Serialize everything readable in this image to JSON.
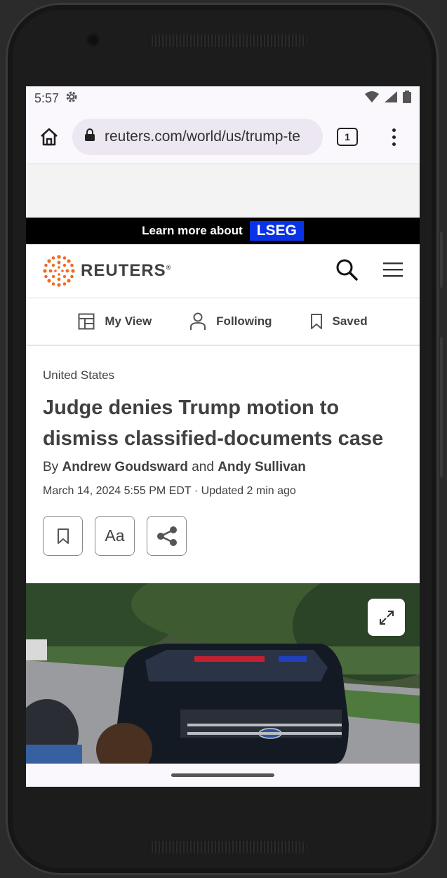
{
  "status_bar": {
    "time": "5:57"
  },
  "browser": {
    "url": "reuters.com/world/us/trump-te",
    "tab_count": "1"
  },
  "ad": {
    "text": "Learn more about",
    "brand": "LSEG"
  },
  "site": {
    "logo_text": "REUTERS",
    "registered": "®"
  },
  "subnav": [
    {
      "label": "My View"
    },
    {
      "label": "Following"
    },
    {
      "label": "Saved"
    }
  ],
  "article": {
    "kicker": "United States",
    "headline": "Judge denies Trump motion to dismiss classified-documents case",
    "byline_prefix": "By",
    "author1": "Andrew Goudsward",
    "byline_and": "and",
    "author2": "Andy Sullivan",
    "dateline": "March 14, 2024 5:55 PM EDT · Updated 2 min ago",
    "text_size_label": "Aa"
  },
  "icons": [
    "settings-icon",
    "wifi-icon",
    "signal-icon",
    "battery-icon",
    "home-icon",
    "lock-icon",
    "tabs-icon",
    "more-icon",
    "search-icon",
    "menu-icon",
    "layout-icon",
    "person-icon",
    "bookmark-icon",
    "share-icon",
    "expand-icon"
  ]
}
